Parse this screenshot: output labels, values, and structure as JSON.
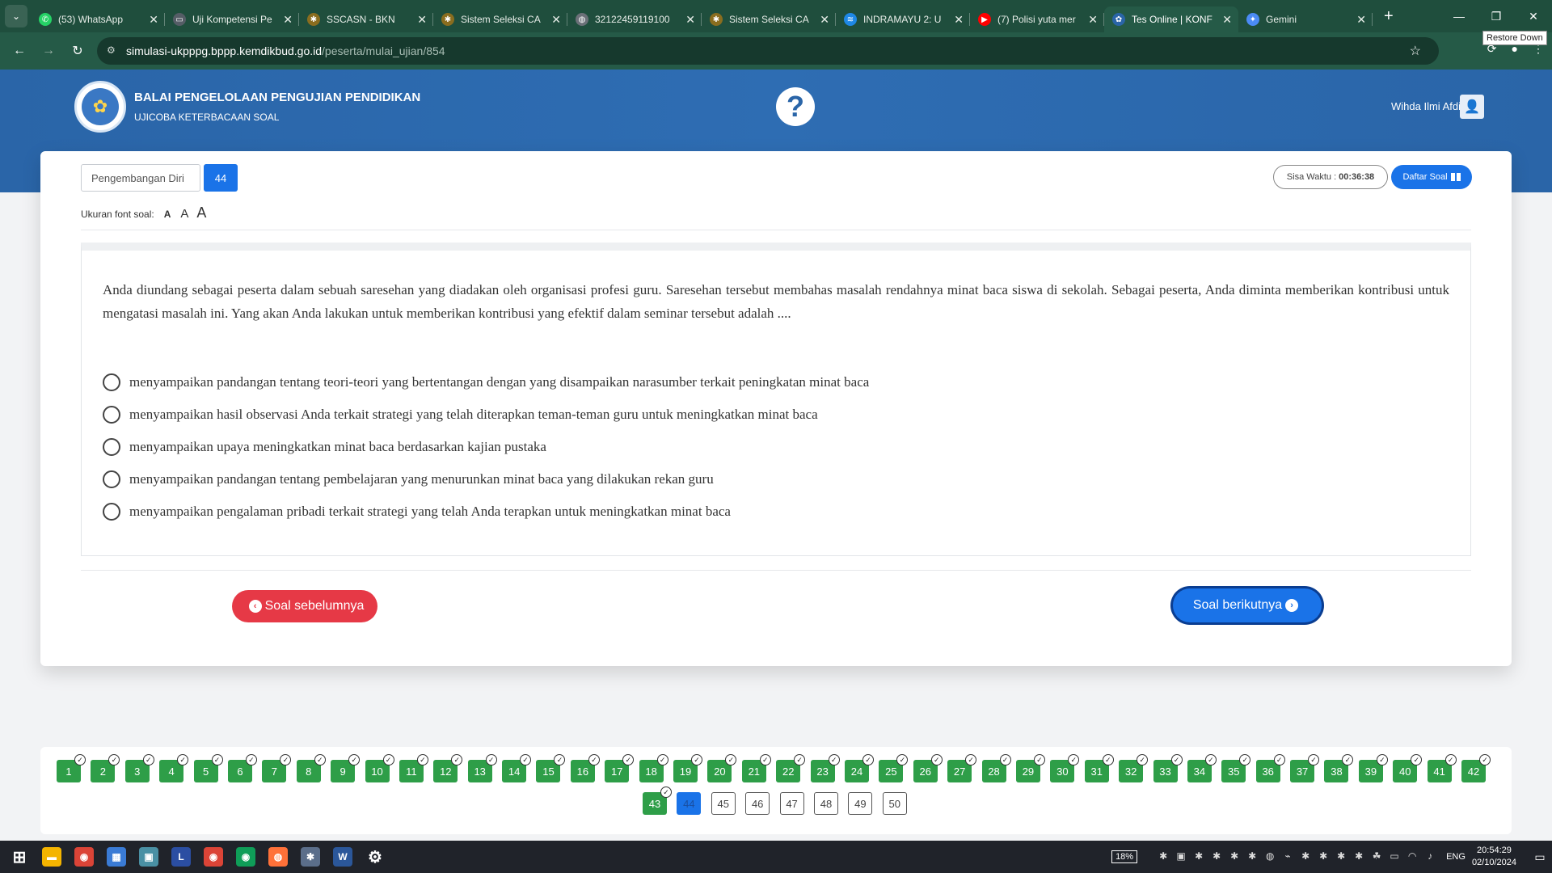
{
  "browser": {
    "tabs": [
      {
        "title": "(53) WhatsApp",
        "color": "#25d366",
        "icon": "whatsapp-icon",
        "glyph": "✆"
      },
      {
        "title": "Uji Kompetensi Pe",
        "color": "#555d66",
        "icon": "page-icon",
        "glyph": "▭"
      },
      {
        "title": "SSCASN - BKN",
        "color": "#8a6d1f",
        "icon": "bkn-icon",
        "glyph": "✱"
      },
      {
        "title": "Sistem Seleksi CA",
        "color": "#8a6d1f",
        "icon": "bkn-icon",
        "glyph": "✱"
      },
      {
        "title": "32122459119100",
        "color": "#6b7078",
        "icon": "globe-icon",
        "glyph": "◍"
      },
      {
        "title": "Sistem Seleksi CA",
        "color": "#8a6d1f",
        "icon": "bkn-icon",
        "glyph": "✱"
      },
      {
        "title": "INDRAMAYU 2: U",
        "color": "#1e88e5",
        "icon": "site-icon",
        "glyph": "≋"
      },
      {
        "title": "(7) Polisi yuta mer",
        "color": "#ff0000",
        "icon": "youtube-icon",
        "glyph": "▶"
      },
      {
        "title": "Tes Online | KONF",
        "color": "#2a65a8",
        "icon": "kemdikbud-icon",
        "glyph": "✿",
        "active": true
      },
      {
        "title": "Gemini",
        "color": "#4b8bf5",
        "icon": "gemini-icon",
        "glyph": "✦"
      }
    ],
    "url_host": "simulasi-ukpppg.bppp.kemdikbud.go.id",
    "url_path": "/peserta/mulai_ujian/854",
    "tooltip": "Restore Down"
  },
  "header": {
    "title": "BALAI PENGELOLAAN PENGUJIAN PENDIDIKAN",
    "subtitle": "UJICOBA KETERBACAAN SOAL",
    "help_symbol": "?",
    "user_name": "Wihda Ilmi Afdilla"
  },
  "exam": {
    "category": "Pengembangan Diri",
    "question_number": "44",
    "timer_label": "Sisa Waktu :",
    "timer_value": "00:36:38",
    "list_button": "Daftar Soal",
    "font_label": "Ukuran font soal:",
    "font_sizes": [
      "A",
      "A",
      "A"
    ],
    "question": "Anda diundang sebagai peserta dalam sebuah saresehan yang diadakan oleh organisasi profesi guru. Saresehan tersebut membahas masalah rendahnya minat baca siswa di sekolah. Sebagai peserta, Anda diminta memberikan kontribusi untuk mengatasi masalah ini. Yang akan Anda lakukan untuk memberikan kontribusi yang efektif dalam seminar tersebut adalah ....",
    "options": [
      "menyampaikan pandangan tentang teori-teori yang bertentangan dengan yang disampaikan narasumber terkait peningkatan minat baca",
      "menyampaikan hasil observasi Anda terkait strategi yang telah diterapkan teman-teman guru untuk meningkatkan minat baca",
      "menyampaikan upaya meningkatkan minat baca berdasarkan kajian pustaka",
      "menyampaikan pandangan tentang pembelajaran yang menurunkan minat baca yang dilakukan rekan guru",
      "menyampaikan pengalaman pribadi terkait strategi yang telah Anda terapkan untuk meningkatkan minat baca"
    ],
    "prev_label": "Soal sebelumnya",
    "next_label": "Soal berikutnya"
  },
  "navigation": {
    "total": 50,
    "answered_up_to": 43,
    "current": 44
  },
  "taskbar": {
    "battery": "18%",
    "lang": "ENG",
    "time": "20:54:29",
    "date": "02/10/2024",
    "apps": [
      {
        "name": "start-icon",
        "color": "transparent",
        "glyph": "⊞"
      },
      {
        "name": "file-explorer-icon",
        "color": "#f4b400",
        "glyph": "▬"
      },
      {
        "name": "chrome-icon",
        "color": "#db4437",
        "glyph": "◉"
      },
      {
        "name": "calculator-icon",
        "color": "#3a7bd5",
        "glyph": "▦"
      },
      {
        "name": "photos-icon",
        "color": "#4a90a4",
        "glyph": "▣"
      },
      {
        "name": "launcher-icon",
        "color": "#2b4ea2",
        "glyph": "L"
      },
      {
        "name": "chrome-active-icon",
        "color": "#db4437",
        "glyph": "◉"
      },
      {
        "name": "chrome-profile-icon",
        "color": "#0f9d58",
        "glyph": "◉"
      },
      {
        "name": "firefox-icon",
        "color": "#ff7139",
        "glyph": "◍"
      },
      {
        "name": "app-icon",
        "color": "#5b6e8a",
        "glyph": "✱"
      },
      {
        "name": "word-icon",
        "color": "#2b579a",
        "glyph": "W"
      },
      {
        "name": "settings-icon",
        "color": "transparent",
        "glyph": "⚙"
      }
    ]
  }
}
